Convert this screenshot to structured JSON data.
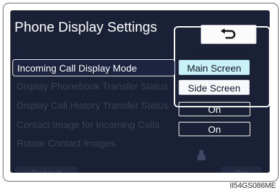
{
  "screen": {
    "title": "Phone Display Settings",
    "back_icon": "return-arrow-icon"
  },
  "settings": [
    {
      "label": "Incoming Call Display Mode",
      "active": true
    },
    {
      "label": "Display Phonebook Transfer Status",
      "active": false
    },
    {
      "label": "Display Call History Transfer Status",
      "active": false
    },
    {
      "label": "Contact Image for Incoming Calls",
      "active": false
    },
    {
      "label": "Rotate Contact Images",
      "active": false
    }
  ],
  "display_mode_options": {
    "main": "Main Screen",
    "side": "Side Screen"
  },
  "values": {
    "call_history": "On",
    "contact_image": "On",
    "rotate_icon": "person-icon"
  },
  "footer": {
    "default_label": "Default",
    "ok_label": "OK"
  },
  "figure_code": "II54GS086ME",
  "colors": {
    "screen_bg": "#1a2036",
    "selected_option": "#c9f1f8",
    "disabled_text": "#3a4156"
  }
}
